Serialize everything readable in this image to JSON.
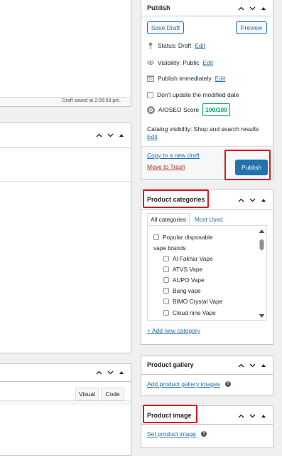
{
  "editor": {
    "draft_saved": "Draft saved at 2:06:58 pm.",
    "tab_visual": "Visual",
    "tab_code": "Code"
  },
  "publish": {
    "title": "Publish",
    "save_draft": "Save Draft",
    "preview": "Preview",
    "status_label": "Status: Draft",
    "status_edit": "Edit",
    "visibility_label": "Visibility: Public",
    "visibility_edit": "Edit",
    "schedule_label": "Publish immediately",
    "schedule_edit": "Edit",
    "dont_update_label": "Don't update the modified date",
    "aioseo_label": "AIOSEO Score",
    "aioseo_score": "100/100",
    "catalog_label": "Catalog visibility: Shop and search results",
    "catalog_edit": "Edit",
    "copy_draft": "Copy to a new draft",
    "trash": "Move to Trash",
    "publish_button": "Publish"
  },
  "categories": {
    "title": "Product categories",
    "tab_all": "All categories",
    "tab_most_used": "Most Used",
    "parent": "Popular disposable vape brands",
    "parent_line1": "Popular disposable",
    "parent_line2": "vape brands",
    "items": [
      "Al Fakhar Vape",
      "ATVS Vape",
      "AUPO Vape",
      "Bang vape",
      "BIMO Crystal Vape",
      "Cloud nine Vape"
    ],
    "add_new": "+ Add new category"
  },
  "gallery": {
    "title": "Product gallery",
    "add_link": "Add product gallery images"
  },
  "image": {
    "title": "Product image",
    "set_link": "Set product image"
  },
  "colors": {
    "accent": "#2271b1",
    "highlight": "#e0161a",
    "score_green": "#00aa63"
  }
}
